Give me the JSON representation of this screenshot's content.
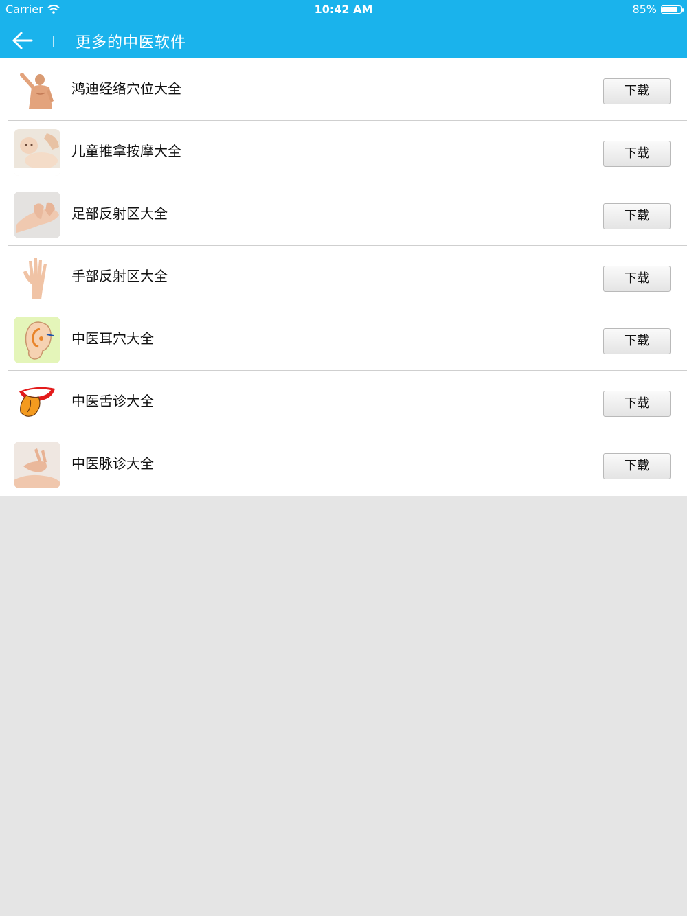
{
  "status_bar": {
    "carrier": "Carrier",
    "time": "10:42 AM",
    "battery_percent": "85%",
    "battery_level": 0.85
  },
  "nav": {
    "back_icon": "arrow-left-icon",
    "title": "更多的中医软件"
  },
  "apps": [
    {
      "name": "鸿迪经络穴位大全",
      "button": "下载",
      "icon": "body-figure-thumbnail"
    },
    {
      "name": "儿童推拿按摩大全",
      "button": "下载",
      "icon": "baby-massage-thumbnail"
    },
    {
      "name": "足部反射区大全",
      "button": "下载",
      "icon": "foot-massage-thumbnail"
    },
    {
      "name": "手部反射区大全",
      "button": "下载",
      "icon": "hand-thumbnail"
    },
    {
      "name": "中医耳穴大全",
      "button": "下载",
      "icon": "ear-thumbnail"
    },
    {
      "name": "中医舌诊大全",
      "button": "下载",
      "icon": "tongue-thumbnail"
    },
    {
      "name": "中医脉诊大全",
      "button": "下载",
      "icon": "pulse-diagnosis-thumbnail"
    }
  ],
  "colors": {
    "header": "#1ab3ec",
    "background": "#e5e5e5"
  }
}
